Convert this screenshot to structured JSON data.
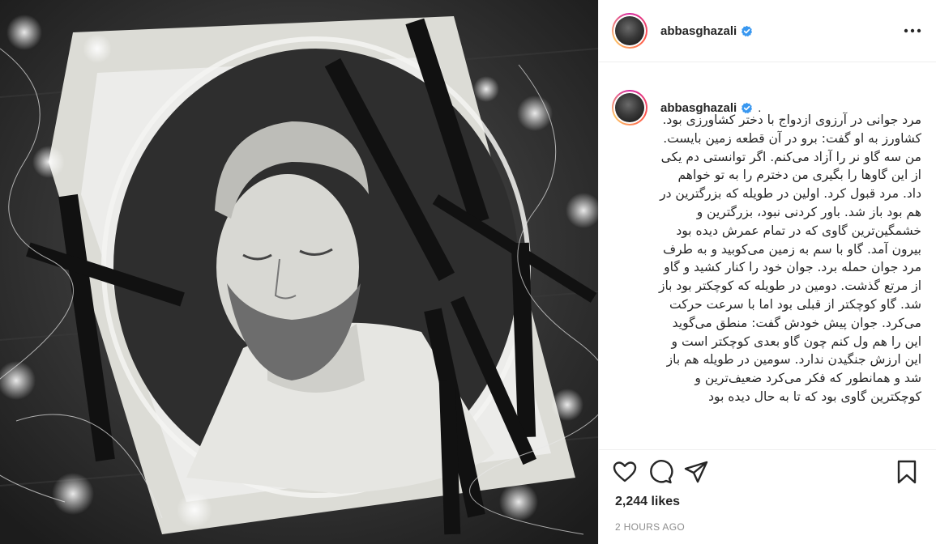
{
  "post": {
    "username": "abbasghazali",
    "verified": true,
    "caption_username": "abbasghazali",
    "caption_prefix": ".",
    "caption": "مرد جوانی در آرزوی ازدواج با دختر کشاورزی بود. کشاورز به او گفت: برو در آن قطعه زمین بایست. من سه گاو نر را آزاد می‌کنم. اگر توانستی دم یکی از این گاوها را بگیری من دخترم را به تو خواهم داد. مرد قبول کرد. اولین در طویله که بزرگترین در هم بود باز شد. باور کردنی نبود، بزرگترین و خشمگین‌ترین گاوی که در تمام عمرش دیده بود بیرون آمد. گاو با سم به زمین می‌کوبید و به طرف مرد جوان حمله برد. جوان خود را کنار کشید و گاو از مرتع گذشت. دومین در طویله که کوچکتر بود باز شد. گاو کوچکتر از قبلی بود اما با سرعت حرکت می‌کرد. جوان پیش خودش گفت: منطق می‌گوید این را هم ول کنم چون گاو بعدی کوچکتر است و این ارزش جنگیدن ندارد. سومین در طویله هم باز شد و همانطور که فکر می‌کرد ضعیف‌ترین و کوچکترین گاوی بود که تا به حال دیده بود",
    "likes": "2,244 likes",
    "time": "2 HOURS AGO"
  },
  "icons": {
    "avatar": "profile-avatar",
    "verified": "verified-badge-icon",
    "more": "more-options-icon",
    "like": "heart-icon",
    "comment": "comment-icon",
    "share": "paper-plane-icon",
    "save": "bookmark-icon"
  },
  "colors": {
    "verified": "#3897f0",
    "muted": "#8e8e8e",
    "text": "#262626"
  }
}
